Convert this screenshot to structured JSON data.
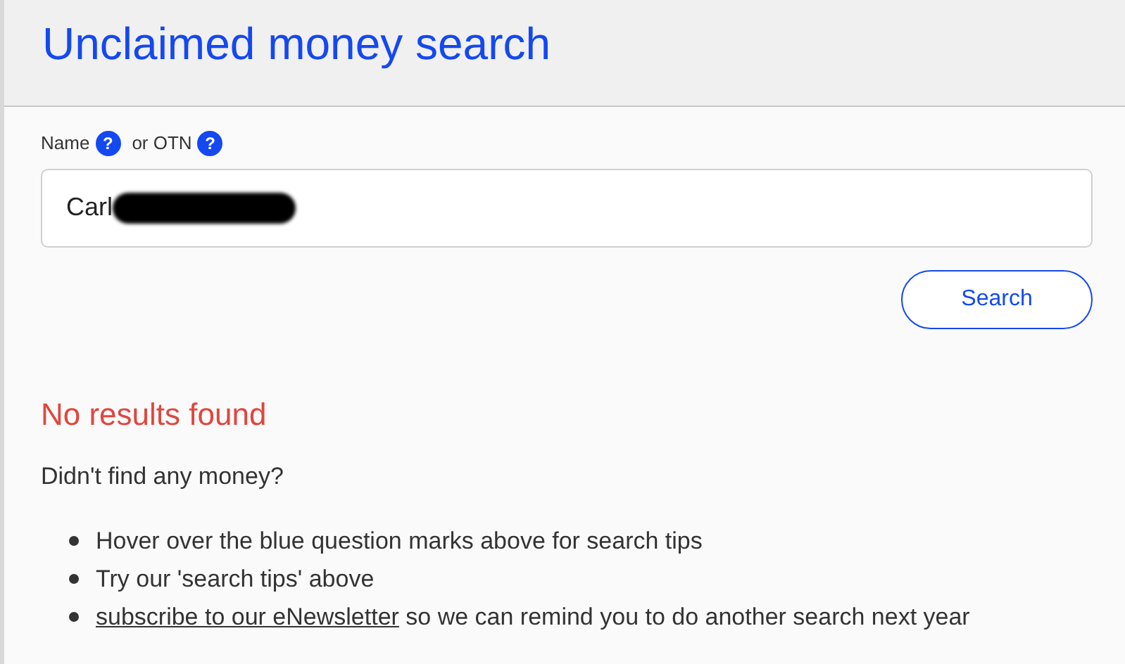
{
  "header": {
    "title": "Unclaimed money search"
  },
  "labels": [
    {
      "text": "Name",
      "help": "?"
    },
    {
      "text": "or OTN",
      "help": "?"
    }
  ],
  "search_field": {
    "value": "Carl",
    "redacted": true
  },
  "search_button": "Search",
  "result": {
    "heading": "No results found",
    "intro": "Didn't find any money?",
    "tips": [
      {
        "text": "Hover over the blue question marks above for search tips"
      },
      {
        "text": "Try our 'search tips' above"
      },
      {
        "link": "subscribe to our eNewsletter",
        "text": " so we can remind you to do another search next year"
      }
    ]
  }
}
